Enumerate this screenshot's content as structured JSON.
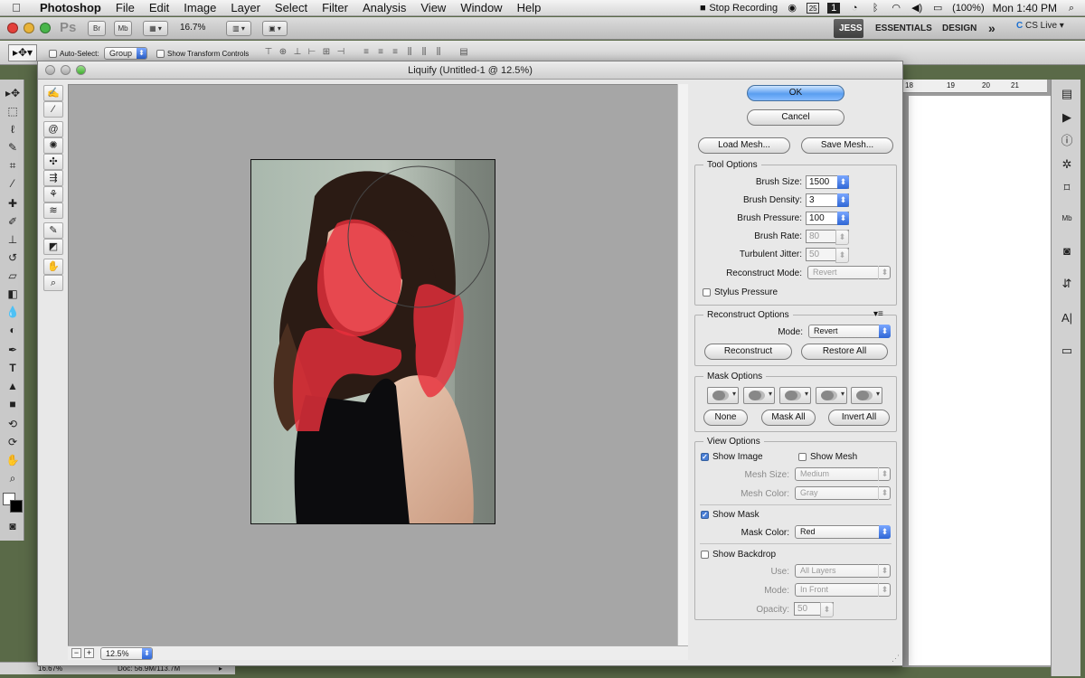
{
  "menubar": {
    "app": "Photoshop",
    "items": [
      "File",
      "Edit",
      "Image",
      "Layer",
      "Select",
      "Filter",
      "Analysis",
      "View",
      "Window",
      "Help"
    ],
    "status": {
      "recording": "Stop Recording",
      "battery_pct": "25",
      "battery": "(100%)",
      "clock": "Mon 1:40 PM"
    }
  },
  "appbar": {
    "ps": "Ps",
    "br": "Br",
    "mb": "Mb",
    "zoom": "16.7%",
    "workspaces": [
      "JESS",
      "ESSENTIALS",
      "DESIGN"
    ],
    "more": "»",
    "cslive": "CS Live"
  },
  "options": {
    "auto_select": "Auto-Select:",
    "auto_select_value": "Group",
    "show_transform": "Show Transform Controls"
  },
  "dialog": {
    "title": "Liquify (Untitled-1 @ 12.5%)",
    "ok": "OK",
    "cancel": "Cancel",
    "load_mesh": "Load Mesh...",
    "save_mesh": "Save Mesh...",
    "tool_options": {
      "title": "Tool Options",
      "brush_size_label": "Brush Size:",
      "brush_size": "1500",
      "brush_density_label": "Brush Density:",
      "brush_density": "3",
      "brush_pressure_label": "Brush Pressure:",
      "brush_pressure": "100",
      "brush_rate_label": "Brush Rate:",
      "brush_rate": "80",
      "turbulent_jitter_label": "Turbulent Jitter:",
      "turbulent_jitter": "50",
      "reconstruct_mode_label": "Reconstruct Mode:",
      "reconstruct_mode": "Revert",
      "stylus_pressure": "Stylus Pressure"
    },
    "reconstruct": {
      "title": "Reconstruct Options",
      "mode_label": "Mode:",
      "mode": "Revert",
      "reconstruct": "Reconstruct",
      "restore_all": "Restore All"
    },
    "mask": {
      "title": "Mask Options",
      "none": "None",
      "mask_all": "Mask All",
      "invert_all": "Invert All"
    },
    "view": {
      "title": "View Options",
      "show_image": "Show Image",
      "show_mesh": "Show Mesh",
      "mesh_size_label": "Mesh Size:",
      "mesh_size": "Medium",
      "mesh_color_label": "Mesh Color:",
      "mesh_color": "Gray",
      "show_mask": "Show Mask",
      "mask_color_label": "Mask Color:",
      "mask_color": "Red",
      "show_backdrop": "Show Backdrop",
      "use_label": "Use:",
      "use": "All Layers",
      "mode_label": "Mode:",
      "mode": "In Front",
      "opacity_label": "Opacity:",
      "opacity": "50"
    },
    "zoom": "12.5%"
  },
  "statusbar": {
    "zoom": "16.67%",
    "doc": "Doc: 56.9M/113.7M"
  },
  "ruler": {
    "ticks": [
      "18",
      "19",
      "20",
      "21"
    ]
  },
  "colors": {
    "mask": "#e8303c",
    "accent": "#2e66d5"
  }
}
